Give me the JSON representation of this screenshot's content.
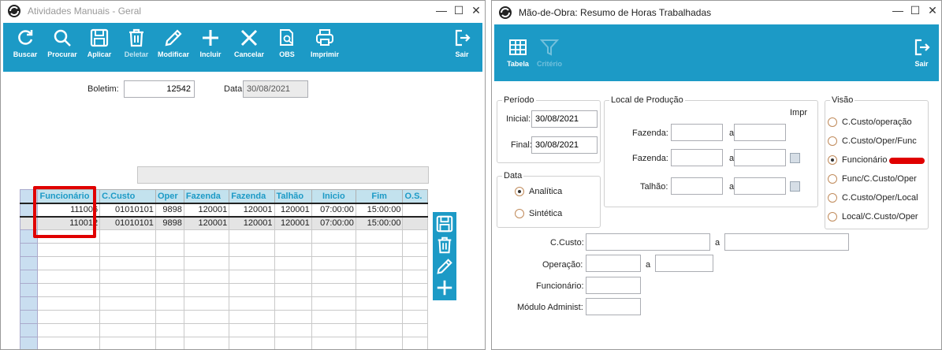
{
  "left_window": {
    "title": "Atividades Manuais - Geral",
    "controls": {
      "minimize": "—",
      "maximize": "☐",
      "close": "✕"
    },
    "toolbar": [
      {
        "label": "Buscar",
        "icon": "refresh-icon",
        "disabled": false
      },
      {
        "label": "Procurar",
        "icon": "search-icon",
        "disabled": false
      },
      {
        "label": "Aplicar",
        "icon": "save-icon",
        "disabled": false
      },
      {
        "label": "Deletar",
        "icon": "trash-icon",
        "disabled": false
      },
      {
        "label": "Modificar",
        "icon": "pencil-icon",
        "disabled": false
      },
      {
        "label": "Incluir",
        "icon": "plus-icon",
        "disabled": false
      },
      {
        "label": "Cancelar",
        "icon": "x-icon",
        "disabled": false
      },
      {
        "label": "OBS",
        "icon": "document-search-icon",
        "disabled": false
      },
      {
        "label": "Imprimir",
        "icon": "printer-icon",
        "disabled": false
      },
      {
        "label": "Sair",
        "icon": "exit-icon",
        "disabled": false
      }
    ],
    "boletim_label": "Boletim:",
    "boletim_value": "12542",
    "data_label": "Data:",
    "data_value": "30/08/2021",
    "grid": {
      "columns": [
        "Funcionário",
        "C.Custo",
        "Oper",
        "Fazenda",
        "Fazenda",
        "Talhão",
        "Inicio",
        "Fim",
        "O.S."
      ],
      "rows": [
        [
          "111006",
          "01010101",
          "9898",
          "120001",
          "120001",
          "120001",
          "07:00:00",
          "15:00:00",
          ""
        ],
        [
          "110012",
          "01010101",
          "9898",
          "120001",
          "120001",
          "120001",
          "07:00:00",
          "15:00:00",
          ""
        ]
      ],
      "empty_rows": 9
    },
    "side_tools": [
      "save-icon",
      "trash-icon",
      "pencil-icon",
      "plus-icon"
    ]
  },
  "right_window": {
    "title": "Mão-de-Obra: Resumo de Horas Trabalhadas",
    "controls": {
      "minimize": "—",
      "maximize": "☐",
      "close": "✕"
    },
    "toolbar": [
      {
        "label": "Tabela",
        "icon": "table-icon",
        "disabled": false
      },
      {
        "label": "Critério",
        "icon": "filter-icon",
        "disabled": true
      },
      {
        "label": "Sair",
        "icon": "exit-icon",
        "disabled": false
      }
    ],
    "periodo": {
      "legend": "Período",
      "inicial_label": "Inicial:",
      "inicial_value": "30/08/2021",
      "final_label": "Final:",
      "final_value": "30/08/2021"
    },
    "data_group": {
      "legend": "Data",
      "options": [
        {
          "label": "Analítica",
          "selected": true
        },
        {
          "label": "Sintética",
          "selected": false
        }
      ]
    },
    "local": {
      "legend": "Local de Produção",
      "impr_label": "Impr",
      "fazenda1_label": "Fazenda:",
      "fazenda2_label": "Fazenda:",
      "talhao_label": "Talhão:",
      "a_label": "a"
    },
    "visao": {
      "legend": "Visão",
      "options": [
        {
          "label": "C.Custo/operação",
          "selected": false
        },
        {
          "label": "C.Custo/Oper/Func",
          "selected": false
        },
        {
          "label": "Funcionário",
          "selected": true
        },
        {
          "label": "Func/C.Custo/Oper",
          "selected": false
        },
        {
          "label": "C.Custo/Oper/Local",
          "selected": false
        },
        {
          "label": "Local/C.Custo/Oper",
          "selected": false
        }
      ]
    },
    "ccusto_label": "C.Custo:",
    "operacao_label": "Operação:",
    "funcionario_label": "Funcionário:",
    "modulo_label": "Módulo Administ:",
    "a_label": "a"
  },
  "colors": {
    "toolbar": "#1c9ac6",
    "highlight": "#e00000",
    "header_bg": "#c3e2ee"
  }
}
